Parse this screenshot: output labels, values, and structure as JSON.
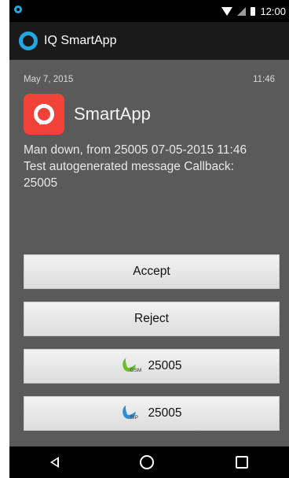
{
  "status_bar": {
    "time": "12:00"
  },
  "app_bar": {
    "title": "IQ SmartApp"
  },
  "notification": {
    "date": "May 7, 2015",
    "time": "11:46",
    "app_name": "SmartApp",
    "message_line1": "Man down, from 25005 07-05-2015 11:46",
    "message_line2": "Test autogenerated message Callback:",
    "message_line3": "25005"
  },
  "buttons": {
    "accept": "Accept",
    "reject": "Reject",
    "gsm_number": "25005",
    "gsm_tag": "GSM",
    "sip_number": "25005",
    "sip_tag": "SIP"
  },
  "colors": {
    "accent": "#21a8e0",
    "app_icon": "#f04236",
    "gsm": "#6cbf2a",
    "sip": "#2f8fd6"
  }
}
